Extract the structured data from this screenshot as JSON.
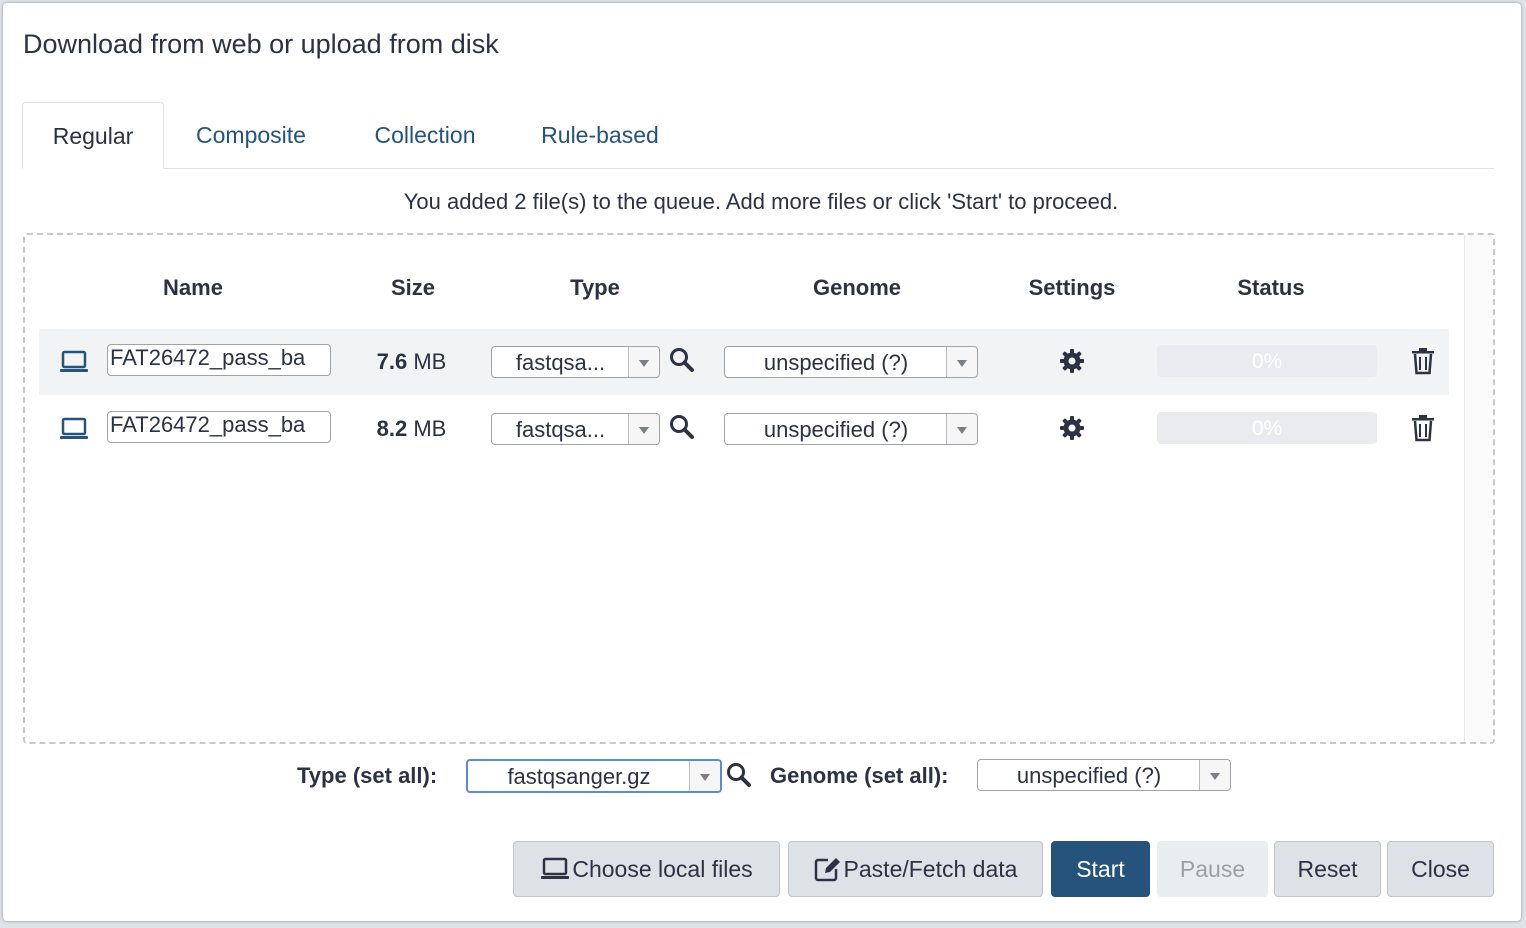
{
  "modal": {
    "title": "Download from web or upload from disk"
  },
  "tabs": [
    {
      "label": "Regular",
      "active": true
    },
    {
      "label": "Composite",
      "active": false
    },
    {
      "label": "Collection",
      "active": false
    },
    {
      "label": "Rule-based",
      "active": false
    }
  ],
  "queue_message": "You added 2 file(s) to the queue. Add more files or click 'Start' to proceed.",
  "columns": {
    "name": "Name",
    "size": "Size",
    "type": "Type",
    "genome": "Genome",
    "settings": "Settings",
    "status": "Status"
  },
  "rows": [
    {
      "icon": "laptop-icon",
      "name": "FAT26472_pass_ba",
      "size_value": "7.6",
      "size_unit": " MB",
      "type": "fastqsa...",
      "genome": "unspecified (?)",
      "status": "0%"
    },
    {
      "icon": "laptop-icon",
      "name": "FAT26472_pass_ba",
      "size_value": "8.2",
      "size_unit": " MB",
      "type": "fastqsa...",
      "genome": "unspecified (?)",
      "status": "0%"
    }
  ],
  "set_all": {
    "type_label": "Type (set all):",
    "type_value": "fastqsanger.gz",
    "genome_label": "Genome (set all):",
    "genome_value": "unspecified (?)"
  },
  "buttons": {
    "choose_local": "Choose local files",
    "paste_fetch": "Paste/Fetch data",
    "start": "Start",
    "pause": "Pause",
    "reset": "Reset",
    "close": "Close"
  },
  "colors": {
    "primary": "#25537b",
    "link": "#25537b",
    "button_bg": "#dee2e6"
  }
}
